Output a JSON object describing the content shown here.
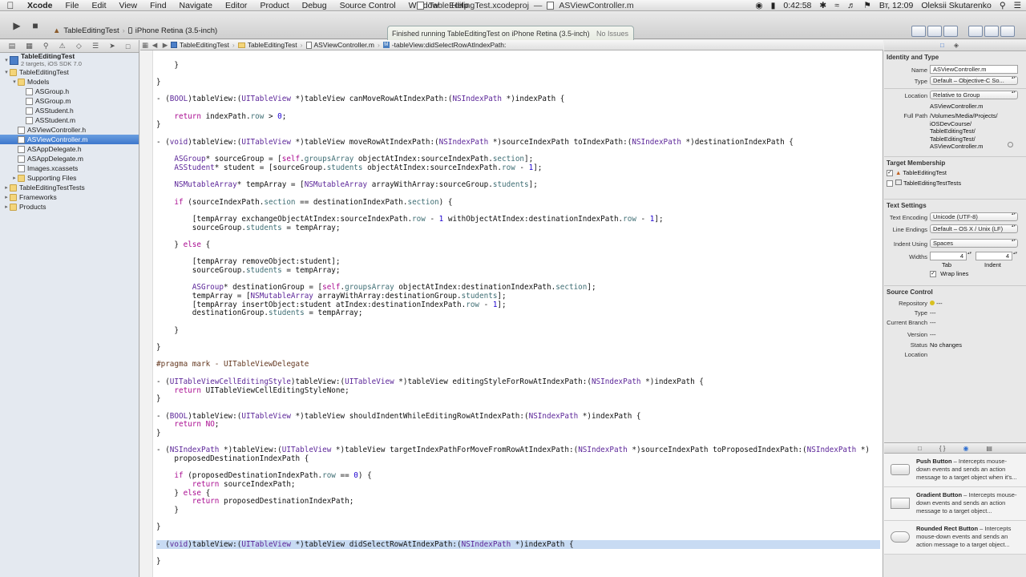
{
  "menubar": {
    "apple_icon": "apple-icon",
    "app": "Xcode",
    "items": [
      "File",
      "Edit",
      "View",
      "Find",
      "Navigate",
      "Editor",
      "Product",
      "Debug",
      "Source Control",
      "Window",
      "Help"
    ],
    "doc_title_1": "TableEditingTest.xcodeproj",
    "doc_sep": "—",
    "doc_title_2": "ASViewController.m",
    "battery_time": "0:42:58",
    "clock": "Вт, 12:09",
    "user": "Oleksii Skutarenko"
  },
  "toolbar": {
    "scheme": "TableEditingTest",
    "destination": "iPhone Retina (3.5-inch)",
    "status_message": "Finished running TableEditingTest on iPhone Retina (3.5-inch)",
    "status_issues": "No Issues"
  },
  "navigator": {
    "project": "TableEditingTest",
    "project_sub": "2 targets, iOS SDK 7.0",
    "items": [
      {
        "label": "TableEditingTest",
        "type": "folder",
        "level": 1,
        "open": true
      },
      {
        "label": "Models",
        "type": "folder",
        "level": 2,
        "open": true
      },
      {
        "label": "ASGroup.h",
        "type": "file",
        "level": 3
      },
      {
        "label": "ASGroup.m",
        "type": "file",
        "level": 3
      },
      {
        "label": "ASStudent.h",
        "type": "file",
        "level": 3
      },
      {
        "label": "ASStudent.m",
        "type": "file",
        "level": 3
      },
      {
        "label": "ASViewController.h",
        "type": "file",
        "level": 2
      },
      {
        "label": "ASViewController.m",
        "type": "file",
        "level": 2,
        "selected": true
      },
      {
        "label": "ASAppDelegate.h",
        "type": "file",
        "level": 2
      },
      {
        "label": "ASAppDelegate.m",
        "type": "file",
        "level": 2
      },
      {
        "label": "Images.xcassets",
        "type": "file",
        "level": 2
      },
      {
        "label": "Supporting Files",
        "type": "folder",
        "level": 2,
        "open": false
      },
      {
        "label": "TableEditingTestTests",
        "type": "folder",
        "level": 1,
        "open": false
      },
      {
        "label": "Frameworks",
        "type": "folder",
        "level": 1,
        "open": false
      },
      {
        "label": "Products",
        "type": "folder",
        "level": 1,
        "open": false
      }
    ]
  },
  "jumpbar": {
    "crumbs": [
      "TableEditingTest",
      "TableEditingTest",
      "ASViewController.m",
      "-tableView:didSelectRowAtIndexPath:"
    ]
  },
  "code": [
    {
      "line": 1,
      "t": "    }"
    },
    {
      "line": 3,
      "t": "}"
    },
    {
      "line": 5,
      "t": "- (BOOL)tableView:(UITableView *)tableView canMoveRowAtIndexPath:(NSIndexPath *)indexPath {"
    },
    {
      "line": 7,
      "t": "    return indexPath.row > 0;"
    },
    {
      "line": 8,
      "t": "}"
    },
    {
      "line": 10,
      "t": "- (void)tableView:(UITableView *)tableView moveRowAtIndexPath:(NSIndexPath *)sourceIndexPath toIndexPath:(NSIndexPath *)destinationIndexPath {"
    },
    {
      "line": 12,
      "t": "    ASGroup* sourceGroup = [self.groupsArray objectAtIndex:sourceIndexPath.section];"
    },
    {
      "line": 13,
      "t": "    ASStudent* student = [sourceGroup.students objectAtIndex:sourceIndexPath.row - 1];"
    },
    {
      "line": 15,
      "t": "    NSMutableArray* tempArray = [NSMutableArray arrayWithArray:sourceGroup.students];"
    },
    {
      "line": 17,
      "t": "    if (sourceIndexPath.section == destinationIndexPath.section) {"
    },
    {
      "line": 19,
      "t": "        [tempArray exchangeObjectAtIndex:sourceIndexPath.row - 1 withObjectAtIndex:destinationIndexPath.row - 1];"
    },
    {
      "line": 20,
      "t": "        sourceGroup.students = tempArray;"
    },
    {
      "line": 22,
      "t": "    } else {"
    },
    {
      "line": 24,
      "t": "        [tempArray removeObject:student];"
    },
    {
      "line": 25,
      "t": "        sourceGroup.students = tempArray;"
    },
    {
      "line": 27,
      "t": "        ASGroup* destinationGroup = [self.groupsArray objectAtIndex:destinationIndexPath.section];"
    },
    {
      "line": 28,
      "t": "        tempArray = [NSMutableArray arrayWithArray:destinationGroup.students];"
    },
    {
      "line": 29,
      "t": "        [tempArray insertObject:student atIndex:destinationIndexPath.row - 1];"
    },
    {
      "line": 30,
      "t": "        destinationGroup.students = tempArray;"
    },
    {
      "line": 32,
      "t": "    }"
    },
    {
      "line": 34,
      "t": "}"
    },
    {
      "line": 36,
      "t": "#pragma mark - UITableViewDelegate"
    },
    {
      "line": 38,
      "t": "- (UITableViewCellEditingStyle)tableView:(UITableView *)tableView editingStyleForRowAtIndexPath:(NSIndexPath *)indexPath {"
    },
    {
      "line": 39,
      "t": "    return UITableViewCellEditingStyleNone;"
    },
    {
      "line": 40,
      "t": "}"
    },
    {
      "line": 42,
      "t": "- (BOOL)tableView:(UITableView *)tableView shouldIndentWhileEditingRowAtIndexPath:(NSIndexPath *)indexPath {"
    },
    {
      "line": 43,
      "t": "    return NO;"
    },
    {
      "line": 44,
      "t": "}"
    },
    {
      "line": 46,
      "t": "- (NSIndexPath *)tableView:(UITableView *)tableView targetIndexPathForMoveFromRowAtIndexPath:(NSIndexPath *)sourceIndexPath toProposedIndexPath:(NSIndexPath *)"
    },
    {
      "line": 47,
      "t": "    proposedDestinationIndexPath {"
    },
    {
      "line": 49,
      "t": "    if (proposedDestinationIndexPath.row == 0) {"
    },
    {
      "line": 50,
      "t": "        return sourceIndexPath;"
    },
    {
      "line": 51,
      "t": "    } else {"
    },
    {
      "line": 52,
      "t": "        return proposedDestinationIndexPath;"
    },
    {
      "line": 53,
      "t": "    }"
    },
    {
      "line": 55,
      "t": "}"
    },
    {
      "line": 57,
      "t": "- (void)tableView:(UITableView *)tableView didSelectRowAtIndexPath:(NSIndexPath *)indexPath {",
      "highlight": true
    },
    {
      "line": 59,
      "t": "}"
    }
  ],
  "inspector": {
    "identity_header": "Identity and Type",
    "name_label": "Name",
    "name_value": "ASViewController.m",
    "type_label": "Type",
    "type_value": "Default – Objective-C So...",
    "location_label": "Location",
    "location_value": "Relative to Group",
    "location_file": "ASViewController.m",
    "fullpath_label": "Full Path",
    "fullpath_lines": [
      "/Volumes/Media/Projects/",
      "iOSDevCourse/",
      "TableEditingTest/",
      "TableEditingTest/",
      "ASViewController.m"
    ],
    "target_header": "Target Membership",
    "targets": [
      {
        "name": "TableEditingTest",
        "checked": true
      },
      {
        "name": "TableEditingTestTests",
        "checked": false
      }
    ],
    "text_header": "Text Settings",
    "encoding_label": "Text Encoding",
    "encoding_value": "Unicode (UTF-8)",
    "endings_label": "Line Endings",
    "endings_value": "Default – OS X / Unix (LF)",
    "indent_label": "Indent Using",
    "indent_value": "Spaces",
    "widths_label": "Widths",
    "tab_width": "4",
    "indent_width": "4",
    "tab_caption": "Tab",
    "indent_caption": "Indent",
    "wrap_label": "Wrap lines",
    "sc_header": "Source Control",
    "repo_label": "Repository",
    "repo_value": "---",
    "sctype_label": "Type",
    "sctype_value": "---",
    "branch_label": "Current Branch",
    "branch_value": "---",
    "version_label": "Version",
    "version_value": "---",
    "status_label": "Status",
    "status_value": "No changes",
    "location2_label": "Location",
    "library": [
      {
        "title": "Push Button",
        "desc": " – Intercepts mouse-down events and sends an action message to a target object when it's..."
      },
      {
        "title": "Gradient Button",
        "desc": " – Intercepts mouse-down events and sends an action message to a target object..."
      },
      {
        "title": "Rounded Rect Button",
        "desc": " – Intercepts mouse-down events and sends an action message to a target object..."
      }
    ]
  }
}
